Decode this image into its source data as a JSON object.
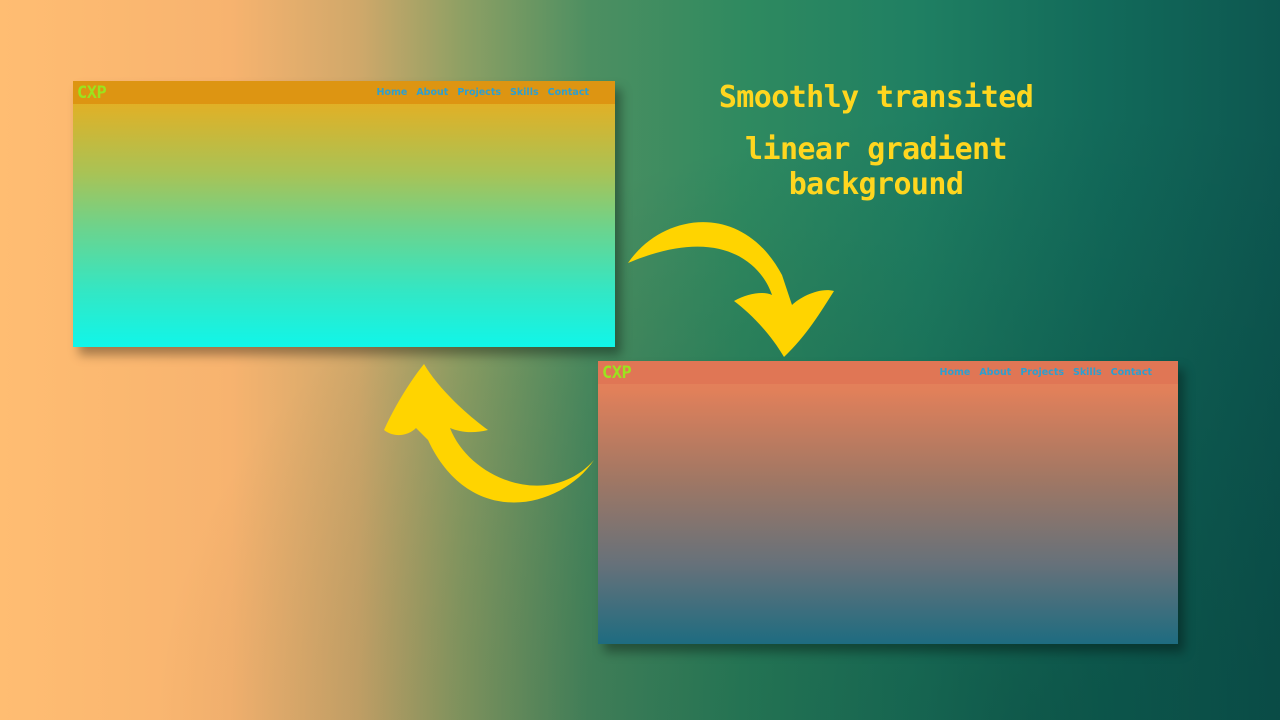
{
  "colors": {
    "headline": "#ffd61f",
    "arrow": "#ffd400",
    "logo": "#9be31e",
    "nav_link": "#2d9fd0"
  },
  "headline": {
    "line1": "Smoothly transited",
    "line2": "linear gradient background"
  },
  "windows": [
    {
      "logo": "CXP",
      "nav": [
        "Home",
        "About",
        "Projects",
        "Skills",
        "Contact"
      ]
    },
    {
      "logo": "CXP",
      "nav": [
        "Home",
        "About",
        "Projects",
        "Skills",
        "Contact"
      ]
    }
  ],
  "icons": [
    "curved-arrow-down-right-icon",
    "curved-arrow-up-left-icon"
  ]
}
